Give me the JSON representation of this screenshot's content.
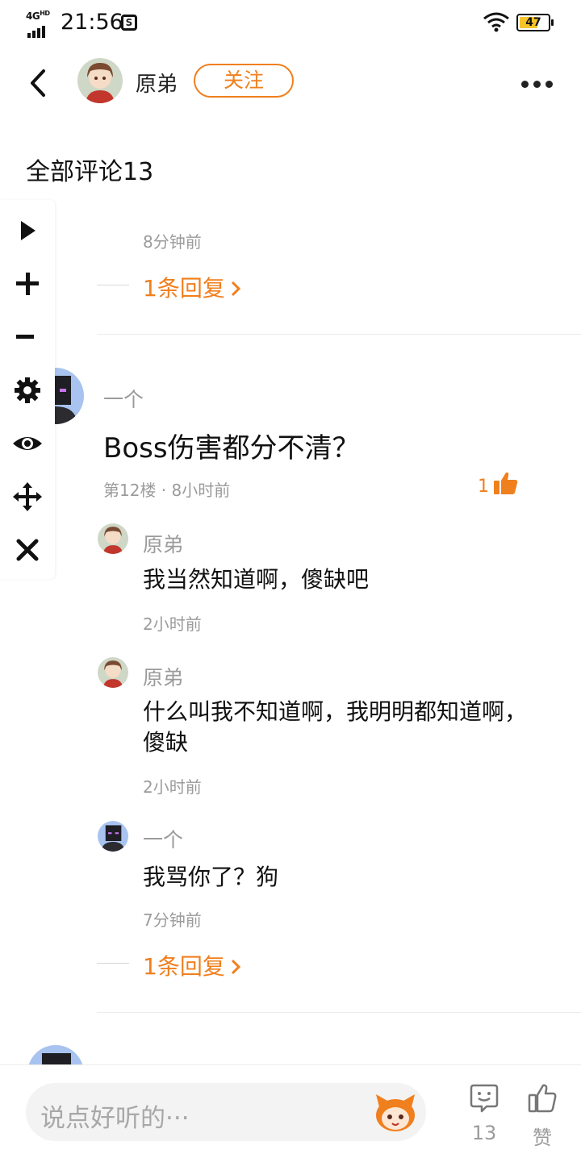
{
  "status_bar": {
    "network": "4G",
    "network_sup": "HD",
    "time": "21:56",
    "screenshot_glyph": "S",
    "battery": "47"
  },
  "header": {
    "user_name": "原弟",
    "follow_label": "关注"
  },
  "section_title": "全部评论13",
  "toolbar_icons": [
    "play-icon",
    "plus-icon",
    "minus-icon",
    "gear-icon",
    "eye-icon",
    "move-icon",
    "close-icon"
  ],
  "comments": [
    {
      "time": "8分钟前",
      "reply_link": "1条回复"
    },
    {
      "author": "一个",
      "text": "Boss伤害都分不清？",
      "floor_meta": "第12楼 · 8小时前",
      "likes": "1",
      "replies": [
        {
          "author": "原弟",
          "text": "我当然知道啊，傻缺吧",
          "time": "2小时前"
        },
        {
          "author": "原弟",
          "text": "什么叫我不知道啊，我明明都知道啊，傻缺",
          "time": "2小时前"
        },
        {
          "author": "一个",
          "text": "我骂你了？狗",
          "time": "7分钟前"
        }
      ],
      "reply_link": "1条回复"
    }
  ],
  "bottom_bar": {
    "input_placeholder": "说点好听的···",
    "comment_count": "13",
    "like_label": "赞"
  },
  "colors": {
    "accent": "#f07f1e",
    "meta_text": "#9b9b9b",
    "battery_fill": "#f6c32a"
  }
}
